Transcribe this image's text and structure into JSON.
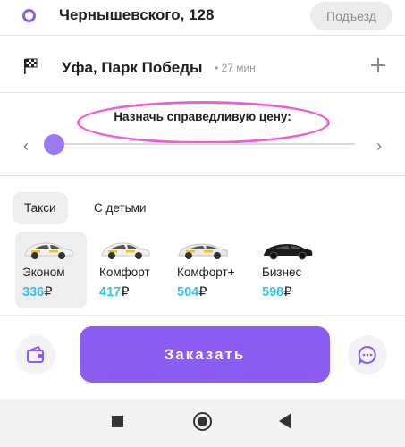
{
  "route": {
    "from_address": "Чернышевского, 128",
    "entrance_label": "Подъезд",
    "to_address": "Уфа, Парк Победы",
    "to_eta": "• 27 мин"
  },
  "price": {
    "title": "Назначь справедливую цену:",
    "slider_fraction": 0.0
  },
  "tabs": [
    {
      "label": "Такси",
      "active": true
    },
    {
      "label": "С детьми",
      "active": false
    }
  ],
  "tariffs": [
    {
      "name": "Эконом",
      "price": "336",
      "currency": "₽",
      "active": true,
      "car_color": "#f1f1f1",
      "accent_color": "#f2c21b"
    },
    {
      "name": "Комфорт",
      "price": "417",
      "currency": "₽",
      "active": false,
      "car_color": "#f1f1f1",
      "accent_color": "#f2c21b"
    },
    {
      "name": "Комфорт+",
      "price": "504",
      "currency": "₽",
      "active": false,
      "car_color": "#e8e8e8",
      "accent_color": "#f2c21b"
    },
    {
      "name": "Бизнес",
      "price": "598",
      "currency": "₽",
      "active": false,
      "car_color": "#1d1d1d",
      "accent_color": "#1d1d1d"
    }
  ],
  "footer": {
    "order_label": "Заказать",
    "wallet_icon": "wallet-icon",
    "chat_icon": "chat-icon"
  },
  "colors": {
    "accent": "#8a5cf0",
    "price": "#35c2e8",
    "highlight": "#e85fd9"
  }
}
